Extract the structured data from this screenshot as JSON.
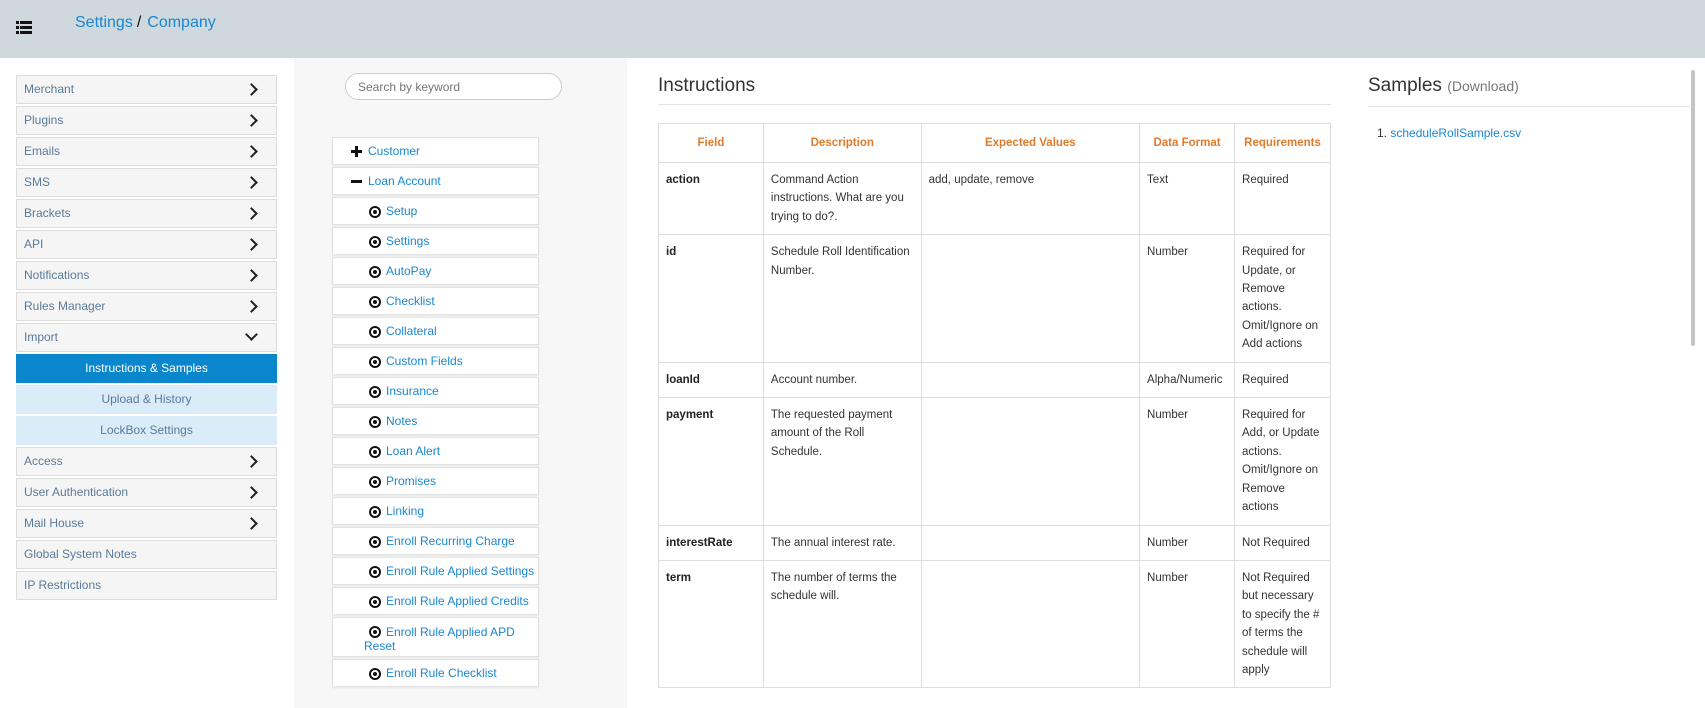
{
  "header": {
    "breadcrumb": [
      "Settings",
      "Company"
    ],
    "separator": "/"
  },
  "sidebar": {
    "items": [
      {
        "label": "Merchant",
        "chevron": "right"
      },
      {
        "label": "Plugins",
        "chevron": "right"
      },
      {
        "label": "Emails",
        "chevron": "right"
      },
      {
        "label": "SMS",
        "chevron": "right"
      },
      {
        "label": "Brackets",
        "chevron": "right"
      },
      {
        "label": "API",
        "chevron": "right"
      },
      {
        "label": "Notifications",
        "chevron": "right"
      },
      {
        "label": "Rules Manager",
        "chevron": "right"
      },
      {
        "label": "Import",
        "chevron": "down"
      },
      {
        "label": "Access",
        "chevron": "right"
      },
      {
        "label": "User Authentication",
        "chevron": "right"
      },
      {
        "label": "Mail House",
        "chevron": "right"
      },
      {
        "label": "Global System Notes",
        "chevron": ""
      },
      {
        "label": "IP Restrictions",
        "chevron": ""
      }
    ],
    "import_sub": [
      {
        "label": "Instructions & Samples",
        "active": true
      },
      {
        "label": "Upload & History",
        "active": false
      },
      {
        "label": "LockBox Settings",
        "active": false
      }
    ]
  },
  "search": {
    "placeholder": "Search by keyword"
  },
  "tree": {
    "customer": "Customer",
    "loan_account": "Loan Account",
    "children": [
      "Setup",
      "Settings",
      "AutoPay",
      "Checklist",
      "Collateral",
      "Custom Fields",
      "Insurance",
      "Notes",
      "Loan Alert",
      "Promises",
      "Linking",
      "Enroll Recurring Charge",
      "Enroll Rule Applied Settings",
      "Enroll Rule Applied Credits"
    ],
    "apd_reset_line1": "Enroll Rule Applied APD",
    "apd_reset_line2": "Reset",
    "last": "Enroll Rule Checklist"
  },
  "instructions": {
    "title": "Instructions",
    "columns": [
      "Field",
      "Description",
      "Expected Values",
      "Data Format",
      "Requirements"
    ],
    "rows": [
      {
        "field": "action",
        "description": "Command Action instructions. What are you trying to do?.",
        "expected": "add, update, remove",
        "format": "Text",
        "requirements": "Required"
      },
      {
        "field": "id",
        "description": "Schedule Roll Identification Number.",
        "expected": "",
        "format": "Number",
        "requirements": "Required for Update, or Remove actions. Omit/Ignore on Add actions"
      },
      {
        "field": "loanId",
        "description": "Account number.",
        "expected": "",
        "format": "Alpha/Numeric",
        "requirements": "Required"
      },
      {
        "field": "payment",
        "description": "The requested payment amount of the Roll Schedule.",
        "expected": "",
        "format": "Number",
        "requirements": "Required for Add, or Update actions. Omit/Ignore on Remove actions"
      },
      {
        "field": "interestRate",
        "description": "The annual interest rate.",
        "expected": "",
        "format": "Number",
        "requirements": "Not Required"
      },
      {
        "field": "term",
        "description": "The number of terms the schedule will.",
        "expected": "",
        "format": "Number",
        "requirements": "Not Required but necessary to specify the # of terms the schedule will apply"
      }
    ]
  },
  "samples": {
    "title": "Samples",
    "download": "(Download)",
    "files": [
      "scheduleRollSample.csv"
    ],
    "index": "1."
  }
}
